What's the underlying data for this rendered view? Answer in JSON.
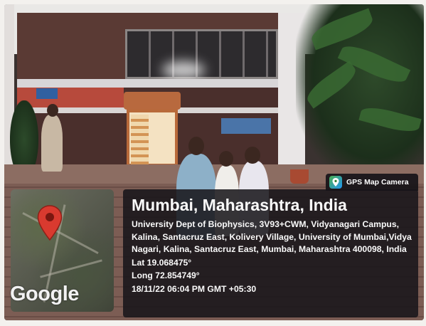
{
  "badge": {
    "app_name": "GPS Map Camera",
    "icon": "gps-map-camera-icon"
  },
  "map": {
    "provider_logo": "Google",
    "pin_icon": "map-pin-icon",
    "pin_color": "#d93a2f"
  },
  "location": {
    "title": "Mumbai, Maharashtra, India",
    "address_lines": [
      "University Dept of Biophysics, 3V93+CWM, Vidyanagari Campus,",
      "Kalina, Santacruz East, Kolivery Village, University of Mumbai,Vidya",
      "Nagari, Kalina, Santacruz East, Mumbai, Maharashtra 400098, India"
    ],
    "latitude": "Lat 19.068475°",
    "longitude": "Long 72.854749°",
    "timestamp": "18/11/22 06:04 PM GMT +05:30"
  }
}
